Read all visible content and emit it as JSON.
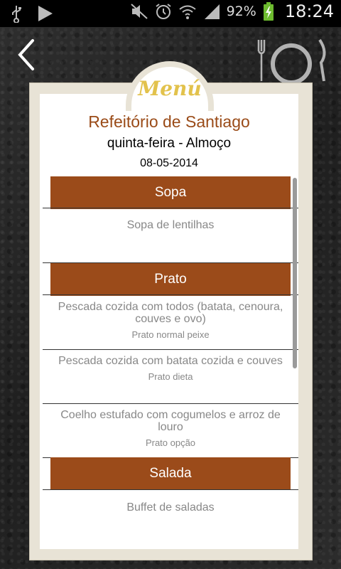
{
  "statusbar": {
    "battery_pct": "92%",
    "time": "18:24"
  },
  "header": {
    "menu_label": "Menú",
    "title": "Refeitório de Santiago",
    "subtitle": "quinta-feira - Almoço",
    "date": "08-05-2014"
  },
  "sections": [
    {
      "label": "Sopa",
      "items": [
        {
          "name": "Sopa de lentilhas",
          "sub": ""
        }
      ]
    },
    {
      "label": "Prato",
      "items": [
        {
          "name": "Pescada cozida com todos (batata, cenoura, couves e ovo)",
          "sub": "Prato normal peixe"
        },
        {
          "name": "Pescada cozida com batata cozida e couves",
          "sub": "Prato dieta"
        },
        {
          "name": "Coelho estufado com cogumelos e arroz de louro",
          "sub": "Prato opção"
        }
      ]
    },
    {
      "label": "Salada",
      "items": [
        {
          "name": "Buffet de saladas",
          "sub": ""
        }
      ]
    }
  ],
  "colors": {
    "accent": "#9b4b1a",
    "title": "#9a4b18",
    "menu_label": "#e2c24c"
  }
}
